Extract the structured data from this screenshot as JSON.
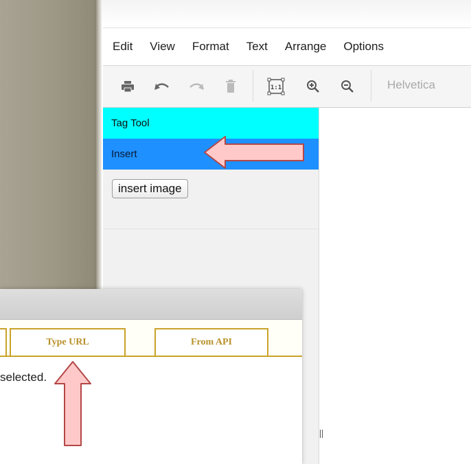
{
  "menubar": {
    "items": [
      "Edit",
      "View",
      "Format",
      "Text",
      "Arrange",
      "Options"
    ]
  },
  "toolbar": {
    "icons": [
      "print-icon",
      "undo-icon",
      "redo-icon",
      "delete-icon",
      "actual-size-icon",
      "zoom-in-icon",
      "zoom-out-icon"
    ],
    "actual_size_label": "1:1",
    "font": "Helvetica"
  },
  "left_panel": {
    "tag_tool": "Tag Tool",
    "insert": "Insert",
    "insert_image_button": "insert image"
  },
  "dialog": {
    "tabs": [
      "Type URL",
      "From API"
    ],
    "status_text": "selected."
  },
  "colors": {
    "tag_tool_bg": "#00ffff",
    "insert_bg": "#1e90ff",
    "tab_accent": "#c9a227",
    "arrow_fill": "#ffc9c9",
    "arrow_stroke": "#b34747"
  }
}
